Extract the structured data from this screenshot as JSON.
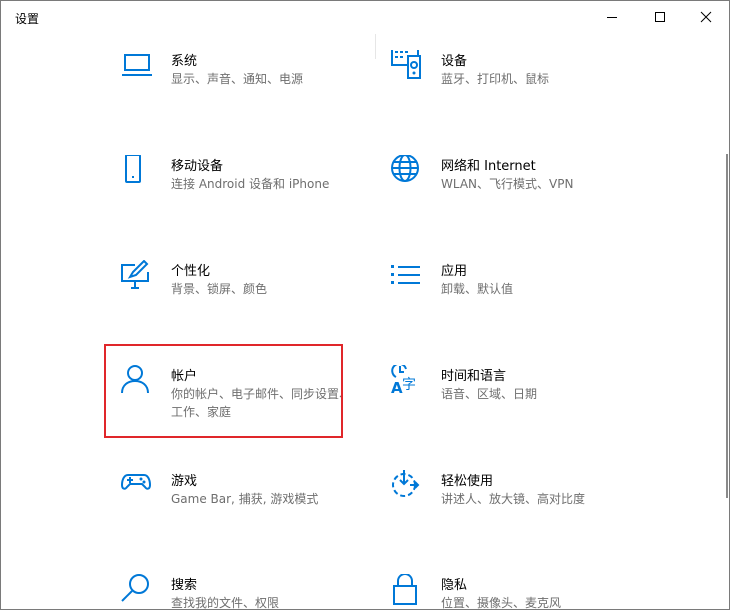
{
  "window": {
    "title": "设置",
    "controls": {
      "minimize": "minimize-icon",
      "maximize": "maximize-icon",
      "close": "close-icon"
    }
  },
  "accent": "#0078d7",
  "selection_color": "#e0262a",
  "tiles": [
    {
      "title": "系统",
      "subtitle": "显示、声音、通知、电源",
      "icon": "laptop-icon"
    },
    {
      "title": "设备",
      "subtitle": "蓝牙、打印机、鼠标",
      "icon": "keyboard-speaker-icon"
    },
    {
      "title": "移动设备",
      "subtitle": "连接 Android 设备和 iPhone",
      "icon": "phone-icon"
    },
    {
      "title": "网络和 Internet",
      "subtitle": "WLAN、飞行模式、VPN",
      "icon": "globe-icon"
    },
    {
      "title": "个性化",
      "subtitle": "背景、锁屏、颜色",
      "icon": "paint-monitor-icon"
    },
    {
      "title": "应用",
      "subtitle": "卸载、默认值",
      "icon": "apps-list-icon"
    },
    {
      "title": "帐户",
      "subtitle": "你的帐户、电子邮件、同步设置、工作、家庭",
      "icon": "person-icon"
    },
    {
      "title": "时间和语言",
      "subtitle": "语音、区域、日期",
      "icon": "time-language-icon"
    },
    {
      "title": "游戏",
      "subtitle": "Game Bar, 捕获, 游戏模式",
      "icon": "gamepad-icon"
    },
    {
      "title": "轻松使用",
      "subtitle": "讲述人、放大镜、高对比度",
      "icon": "ease-of-access-icon"
    },
    {
      "title": "搜索",
      "subtitle": "查找我的文件、权限",
      "icon": "search-icon"
    },
    {
      "title": "隐私",
      "subtitle": "位置、摄像头、麦克风",
      "icon": "lock-icon"
    }
  ]
}
